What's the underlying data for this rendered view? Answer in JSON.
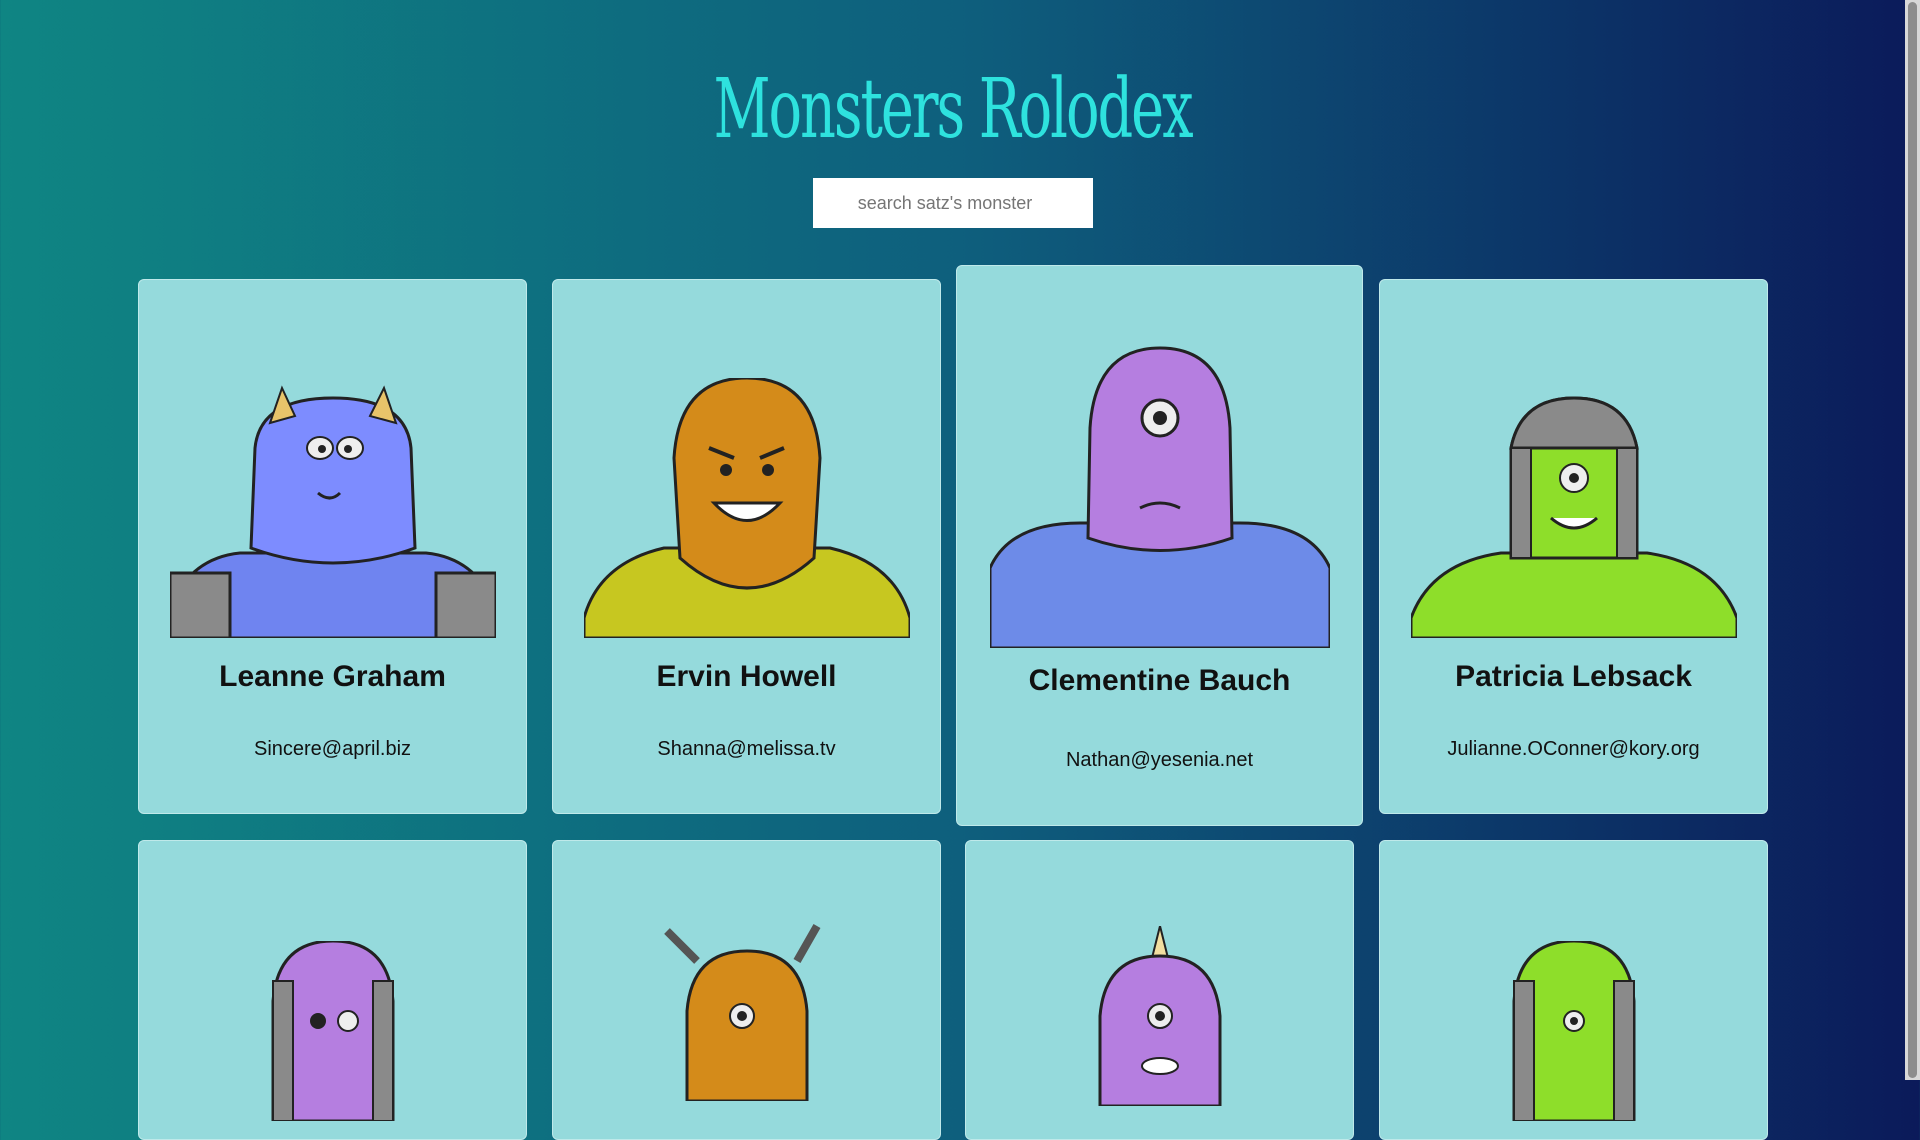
{
  "app": {
    "title": "Monsters Rolodex"
  },
  "search": {
    "placeholder": "search satz's monster"
  },
  "monsters": [
    {
      "name": "Leanne Graham",
      "email": "Sincere@april.biz",
      "color": "#7d8cff",
      "icon": "monster-horned"
    },
    {
      "name": "Ervin Howell",
      "email": "Shanna@melissa.tv",
      "color": "#d48b1a",
      "icon": "monster-gold"
    },
    {
      "name": "Clementine Bauch",
      "email": "Nathan@yesenia.net",
      "color": "#b57ee0",
      "icon": "monster-cyclops"
    },
    {
      "name": "Patricia Lebsack",
      "email": "Julianne.OConner@kory.org",
      "color": "#8ede2a",
      "icon": "monster-helmet"
    },
    {
      "name": "",
      "email": "",
      "color": "#b57ee0",
      "icon": "monster-robot"
    },
    {
      "name": "",
      "email": "",
      "color": "#d48b1a",
      "icon": "monster-antenna"
    },
    {
      "name": "",
      "email": "",
      "color": "#b57ee0",
      "icon": "monster-horn"
    },
    {
      "name": "",
      "email": "",
      "color": "#8ede2a",
      "icon": "monster-robot-green"
    }
  ]
}
